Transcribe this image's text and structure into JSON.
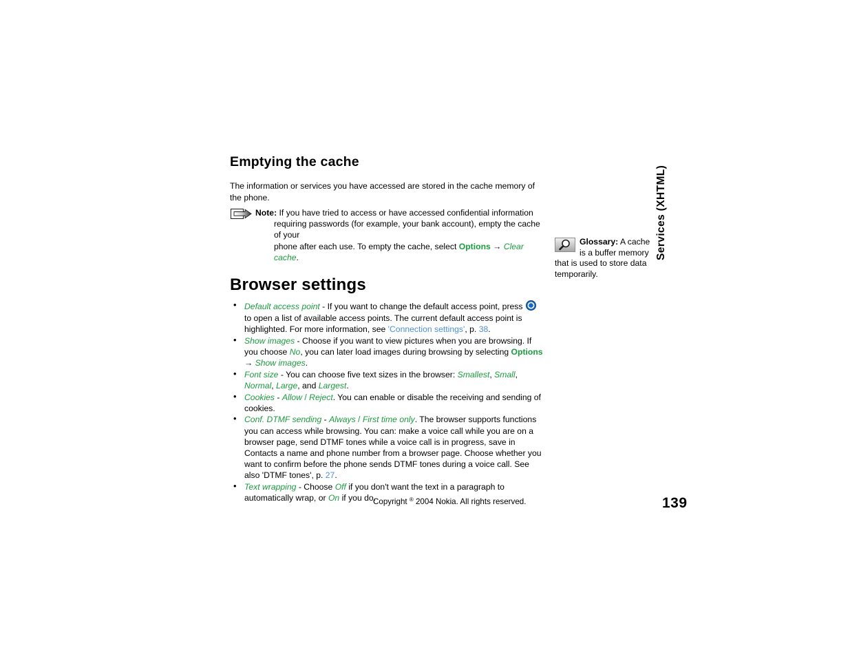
{
  "page": {
    "number": "139",
    "side_tab": "Services (XHTML)",
    "footer_copyright_prefix": "Copyright ",
    "footer_copyright_symbol": "®",
    "footer_copyright_suffix": " 2004 Nokia. All rights reserved."
  },
  "colors": {
    "green": "#1b9b3e",
    "link_blue": "#4b90d6",
    "navi_blue": "#1469c0",
    "text": "#000000"
  },
  "section_cache": {
    "heading": "Emptying the cache",
    "intro": "The information or services you have accessed are stored in the cache memory of the phone.",
    "note": {
      "icon": "note-arrow-icon",
      "label": "Note:",
      "line1": "If you have tried to access or have accessed confidential information",
      "line2": "requiring passwords (for example, your bank account), empty the cache of your",
      "line3_a": "phone after each use. To empty the cache, select ",
      "line3_options": "Options",
      "line3_arrow": " → ",
      "line3_value": "Clear cache",
      "line3_end": "."
    }
  },
  "section_browser": {
    "heading": "Browser settings",
    "bullets": [
      {
        "term": "Default access point",
        "dash": " - ",
        "text_a": "If you want to change the default access point, press ",
        "icon": "navi-key-icon",
        "text_b": " to open a list of available access points. The current default access point is highlighted. For more information, see ",
        "link": "'Connection settings'",
        "text_c": ", p. ",
        "page_ref": "38",
        "text_d": "."
      },
      {
        "term": "Show images",
        "dash": " - ",
        "text_a": "Choose if you want to view pictures when you are browsing. If you choose ",
        "value1": "No",
        "text_b": ", you can later load images during browsing by selecting ",
        "options": "Options",
        "arrow": " → ",
        "value2": "Show images",
        "text_c": "."
      },
      {
        "term": "Font size",
        "dash": " - ",
        "text_a": "You can choose five text sizes in the browser: ",
        "sizes": [
          "Smallest",
          "Small",
          "Normal",
          "Large"
        ],
        "text_b": ", and ",
        "last_size": "Largest",
        "text_c": "."
      },
      {
        "term": "Cookies",
        "dash": " - ",
        "value1": "Allow",
        "sep": " / ",
        "value2": "Reject",
        "text_a": ". You can enable or disable the receiving and sending of cookies."
      },
      {
        "term": "Conf. DTMF sending",
        "dash": " - ",
        "value1": "Always",
        "sep": " / ",
        "value2": "First time only",
        "text_a": ". The browser supports functions you can access while browsing. You can: make a voice call while you are on a browser page, send DTMF tones while a voice call is in progress, save in Contacts a name and phone number from a browser page. Choose whether you want to confirm before the phone sends DTMF tones during a voice call. See also 'DTMF tones', p. ",
        "page_ref": "27",
        "text_b": "."
      },
      {
        "term": "Text wrapping",
        "dash": " - ",
        "text_a": "Choose ",
        "value1": "Off",
        "text_b": " if you don't want the text in a paragraph to automatically wrap, or ",
        "value2": "On",
        "text_c": " if you do."
      }
    ]
  },
  "glossary": {
    "icon": "magnifier-icon",
    "label": "Glossary:",
    "text": " A cache is a buffer memory that is used to store data temporarily."
  }
}
